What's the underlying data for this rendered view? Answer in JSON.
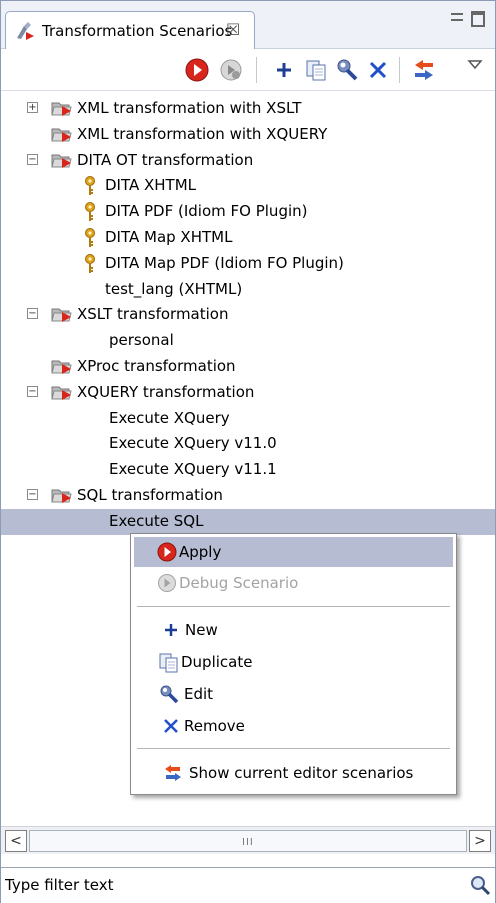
{
  "view": {
    "title": "Transformation Scenarios",
    "close_glyph": "☒"
  },
  "toolbar": {
    "buttons": [
      {
        "name": "apply-icon"
      },
      {
        "name": "debug-icon"
      },
      {
        "name": "new-icon"
      },
      {
        "name": "duplicate-icon"
      },
      {
        "name": "edit-icon"
      },
      {
        "name": "remove-icon"
      },
      {
        "name": "show-current-editor-icon"
      },
      {
        "name": "view-menu-icon"
      }
    ]
  },
  "tree": {
    "items": [
      {
        "label": "XML transformation with XSLT",
        "level": 0,
        "expander": "+",
        "icon": "folder"
      },
      {
        "label": "XML transformation with XQUERY",
        "level": 0,
        "expander": "",
        "icon": "folder"
      },
      {
        "label": "DITA OT transformation",
        "level": 0,
        "expander": "−",
        "icon": "folder"
      },
      {
        "label": "DITA XHTML",
        "level": 1,
        "expander": "",
        "icon": "key"
      },
      {
        "label": "DITA PDF (Idiom FO Plugin)",
        "level": 1,
        "expander": "",
        "icon": "key"
      },
      {
        "label": "DITA Map XHTML",
        "level": 1,
        "expander": "",
        "icon": "key"
      },
      {
        "label": "DITA Map PDF (Idiom FO Plugin)",
        "level": 1,
        "expander": "",
        "icon": "key"
      },
      {
        "label": "test_lang (XHTML)",
        "level": 1,
        "expander": "",
        "icon": ""
      },
      {
        "label": "XSLT transformation",
        "level": 0,
        "expander": "−",
        "icon": "folder"
      },
      {
        "label": "personal",
        "level": 1,
        "expander": "",
        "icon": ""
      },
      {
        "label": "XProc transformation",
        "level": 0,
        "expander": "",
        "icon": "folder"
      },
      {
        "label": "XQUERY transformation",
        "level": 0,
        "expander": "−",
        "icon": "folder"
      },
      {
        "label": "Execute XQuery",
        "level": 1,
        "expander": "",
        "icon": ""
      },
      {
        "label": "Execute XQuery v11.0",
        "level": 1,
        "expander": "",
        "icon": ""
      },
      {
        "label": "Execute XQuery v11.1",
        "level": 1,
        "expander": "",
        "icon": ""
      },
      {
        "label": "SQL transformation",
        "level": 0,
        "expander": "−",
        "icon": "folder"
      },
      {
        "label": "Execute SQL",
        "level": 1,
        "expander": "",
        "icon": "",
        "selected": true
      }
    ]
  },
  "context_menu": {
    "items": [
      {
        "label": "Apply",
        "icon": "apply-icon",
        "highlighted": true
      },
      {
        "label": "Debug Scenario",
        "icon": "debug-icon",
        "disabled": true
      },
      {
        "label": "New",
        "icon": "new-icon"
      },
      {
        "label": "Duplicate",
        "icon": "duplicate-icon"
      },
      {
        "label": "Edit",
        "icon": "edit-icon"
      },
      {
        "label": "Remove",
        "icon": "remove-icon"
      },
      {
        "label": "Show current editor scenarios",
        "icon": "show-current-editor-icon"
      }
    ]
  },
  "scrollbar": {
    "left_glyph": "<",
    "right_glyph": ">",
    "grip": "III"
  },
  "filter": {
    "placeholder": "Type filter text"
  },
  "colors": {
    "selection": "#b6bcd2",
    "apply_red": "#d9261c",
    "remove_blue": "#1f4fcc"
  }
}
